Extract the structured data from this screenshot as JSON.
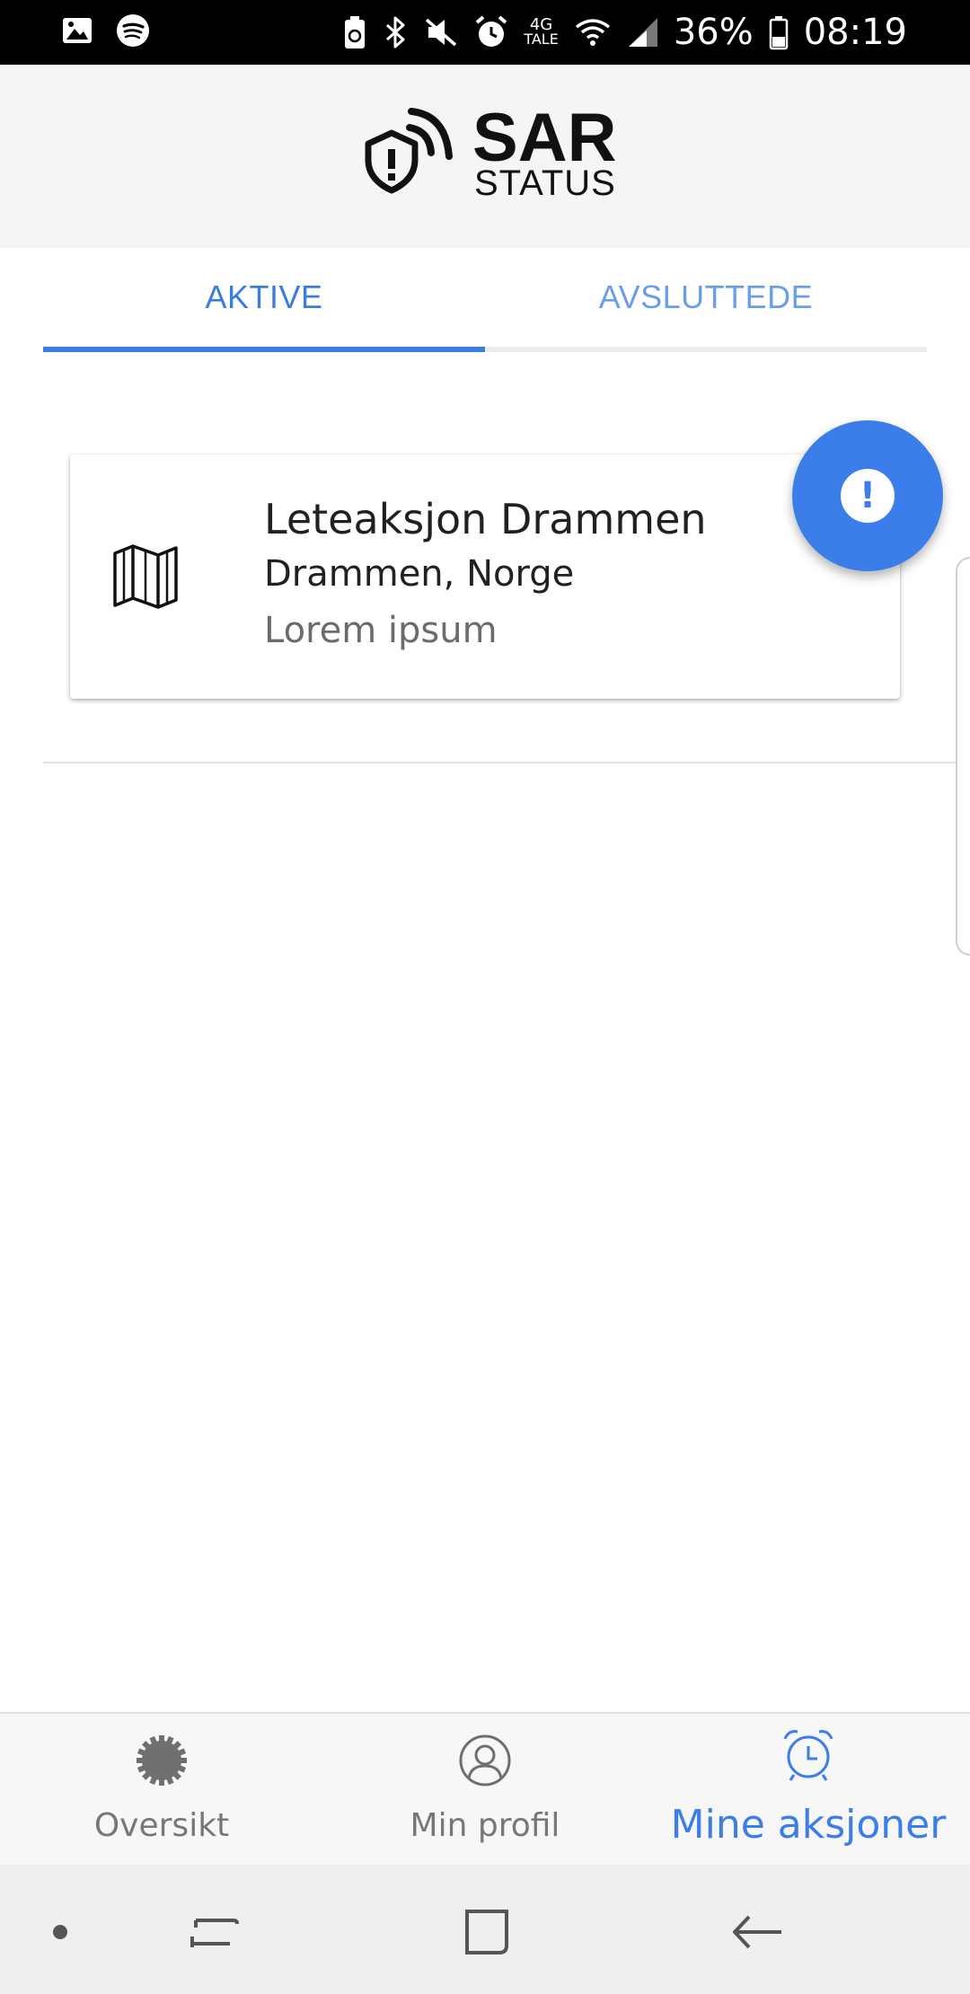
{
  "status_bar": {
    "network_label": "4G",
    "network_sub": "TALE",
    "battery": "36%",
    "time": "08:19",
    "icons": [
      "gallery-icon",
      "spotify-icon",
      "battery-saver-icon",
      "bluetooth-icon",
      "mute-icon",
      "alarm-icon",
      "wifi-icon",
      "signal-icon",
      "battery-icon"
    ]
  },
  "header": {
    "logo_main": "SAR",
    "logo_sub": "STATUS"
  },
  "tabs": [
    {
      "label": "AKTIVE",
      "active": true
    },
    {
      "label": "AVSLUTTEDE",
      "active": false
    }
  ],
  "cards": [
    {
      "icon": "map-icon",
      "title": "Leteaksjon Drammen",
      "location": "Drammen, Norge",
      "description": "Lorem ipsum"
    }
  ],
  "fab": {
    "icon": "alert-icon",
    "symbol": "!"
  },
  "bottom_nav": [
    {
      "label": "Oversikt",
      "icon": "gear-icon",
      "active": false
    },
    {
      "label": "Min profil",
      "icon": "user-icon",
      "active": false
    },
    {
      "label": "Mine aksjoner",
      "icon": "alarm-clock-icon",
      "active": true
    }
  ],
  "colors": {
    "accent": "#3b7de9",
    "tab_active": "#3b7ddd",
    "tab_inactive": "#6a9fe8",
    "muted_text": "#777777"
  }
}
